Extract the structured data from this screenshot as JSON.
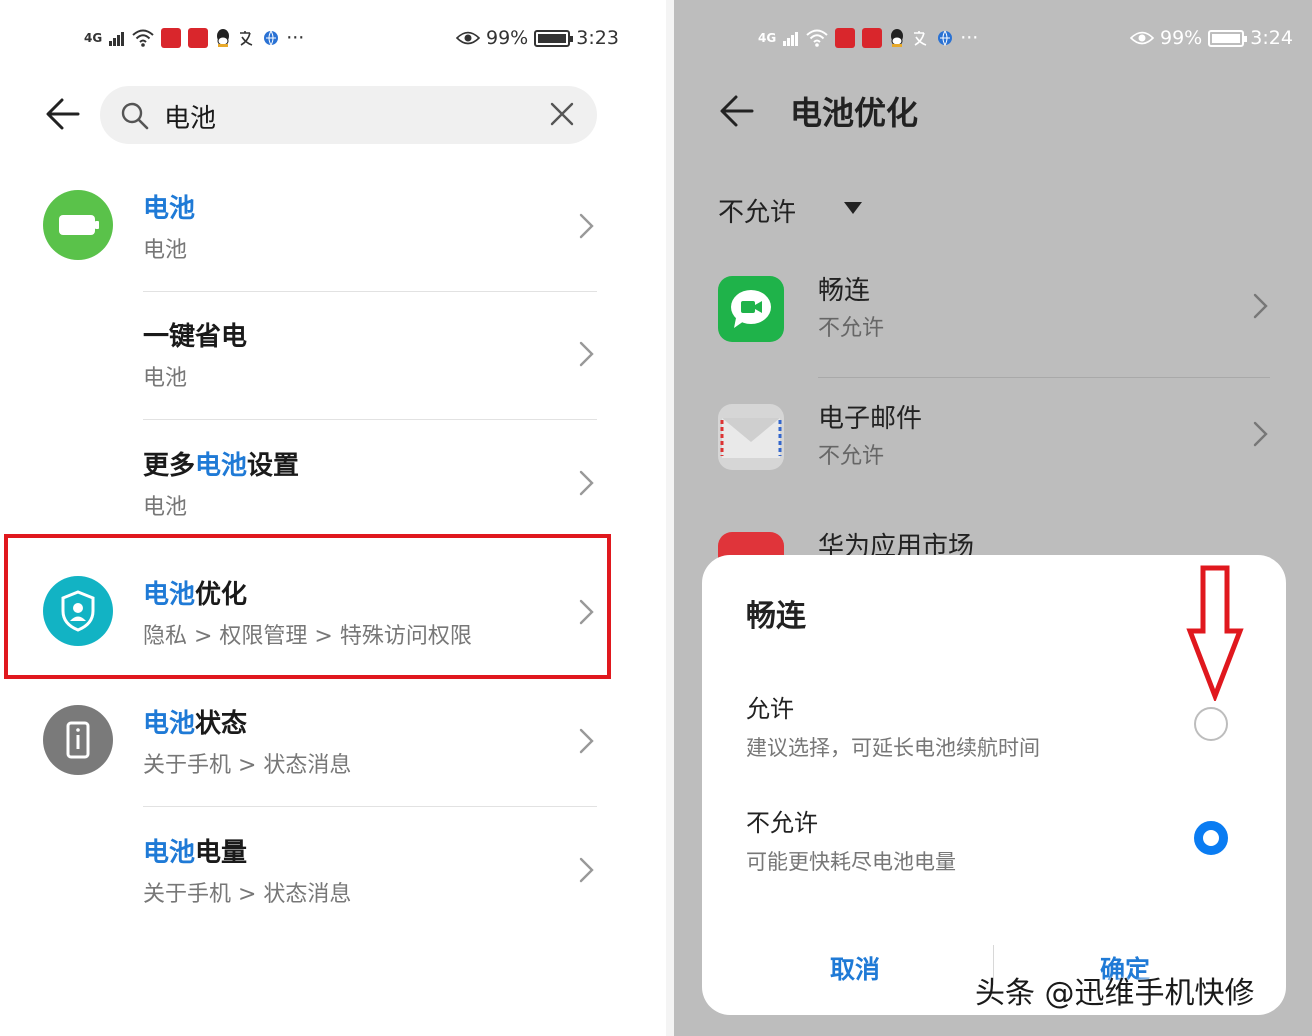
{
  "left": {
    "status": {
      "signal": "4G",
      "battery_pct": "99%",
      "battery_level": 0.99,
      "time": "3:23"
    },
    "search": {
      "query": "电池",
      "icons": [
        "back-arrow-icon",
        "search-icon",
        "clear-icon"
      ]
    },
    "results": [
      {
        "title_hl": "电池",
        "title_rest": "",
        "subtitle": "电池",
        "icon": "battery-icon",
        "icon_color": "#5ac24a"
      },
      {
        "title_hl": "",
        "title_pre": "一键省电",
        "title_rest": "",
        "subtitle": "电池"
      },
      {
        "title_pre": "更多",
        "title_hl": "电池",
        "title_rest": "设置",
        "subtitle": "电池"
      },
      {
        "title_hl": "电池",
        "title_rest": "优化",
        "subtitle": "隐私 > 权限管理 > 特殊访问权限",
        "icon": "shield-user-icon",
        "icon_color": "#12b3c4"
      },
      {
        "title_hl": "电池",
        "title_rest": "状态",
        "subtitle": "关于手机 > 状态消息",
        "icon": "phone-info-icon",
        "icon_color": "#7a7a7a"
      },
      {
        "title_hl": "电池",
        "title_rest": "电量",
        "subtitle": "关于手机 > 状态消息"
      }
    ],
    "highlight_color": "#e0181e"
  },
  "right": {
    "status": {
      "signal": "4G",
      "battery_pct": "99%",
      "battery_level": 0.99,
      "time": "3:24"
    },
    "header_title": "电池优化",
    "filter_label": "不允许",
    "apps": [
      {
        "name": "畅连",
        "status": "不允许",
        "icon": "changlian-app-icon",
        "color": "#1fb34a"
      },
      {
        "name": "电子邮件",
        "status": "不允许",
        "icon": "email-app-icon",
        "color": "#e6e6e6"
      },
      {
        "name": "华为应用市场",
        "status": "",
        "icon": "appgallery-app-icon",
        "color": "#e0343a"
      }
    ],
    "dialog": {
      "title": "畅连",
      "options": [
        {
          "label": "允许",
          "desc": "建议选择，可延长电池续航时间",
          "selected": false
        },
        {
          "label": "不允许",
          "desc": "可能更快耗尽电池电量",
          "selected": true
        }
      ],
      "cancel_label": "取消",
      "confirm_label": "确定"
    },
    "annotation_arrow_color": "#e0181e"
  },
  "watermark": "头条 @迅维手机快修",
  "accent_color": "#1f7ad6"
}
